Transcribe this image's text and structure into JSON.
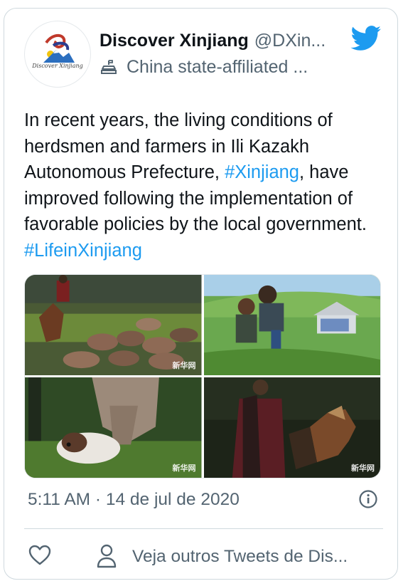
{
  "author": {
    "display_name": "Discover Xinjiang",
    "handle": "@DXin...",
    "affiliation": "China state-affiliated ...",
    "avatar_caption": "Discover Xinjiang"
  },
  "tweet": {
    "text_before": "In recent years, the living conditions of herdsmen and farmers in Ili Kazakh Autonomous Prefecture, ",
    "hashtag1": "#Xinjiang",
    "text_middle": ", have improved following the implementation of favorable policies by the local government. ",
    "hashtag2": "#LifeinXinjiang"
  },
  "media": {
    "watermark": "新华网",
    "photos": [
      {
        "subject": "horseman-and-sheep-photo"
      },
      {
        "subject": "children-playing-photo"
      },
      {
        "subject": "cow-and-calf-photo"
      },
      {
        "subject": "horse-rider-photo"
      }
    ]
  },
  "meta": {
    "timestamp": "5:11 AM · 14 de jul de 2020"
  },
  "actions": {
    "more_tweets_label": "Veja outros Tweets de Dis..."
  },
  "colors": {
    "accent": "#1d9bf0",
    "secondary_text": "#536471",
    "border": "#cfd9de"
  },
  "icons": {
    "bird": "twitter-bird-icon",
    "affiliation": "state-affiliated-icon",
    "info": "info-icon",
    "like": "heart-icon",
    "profile": "person-icon"
  }
}
